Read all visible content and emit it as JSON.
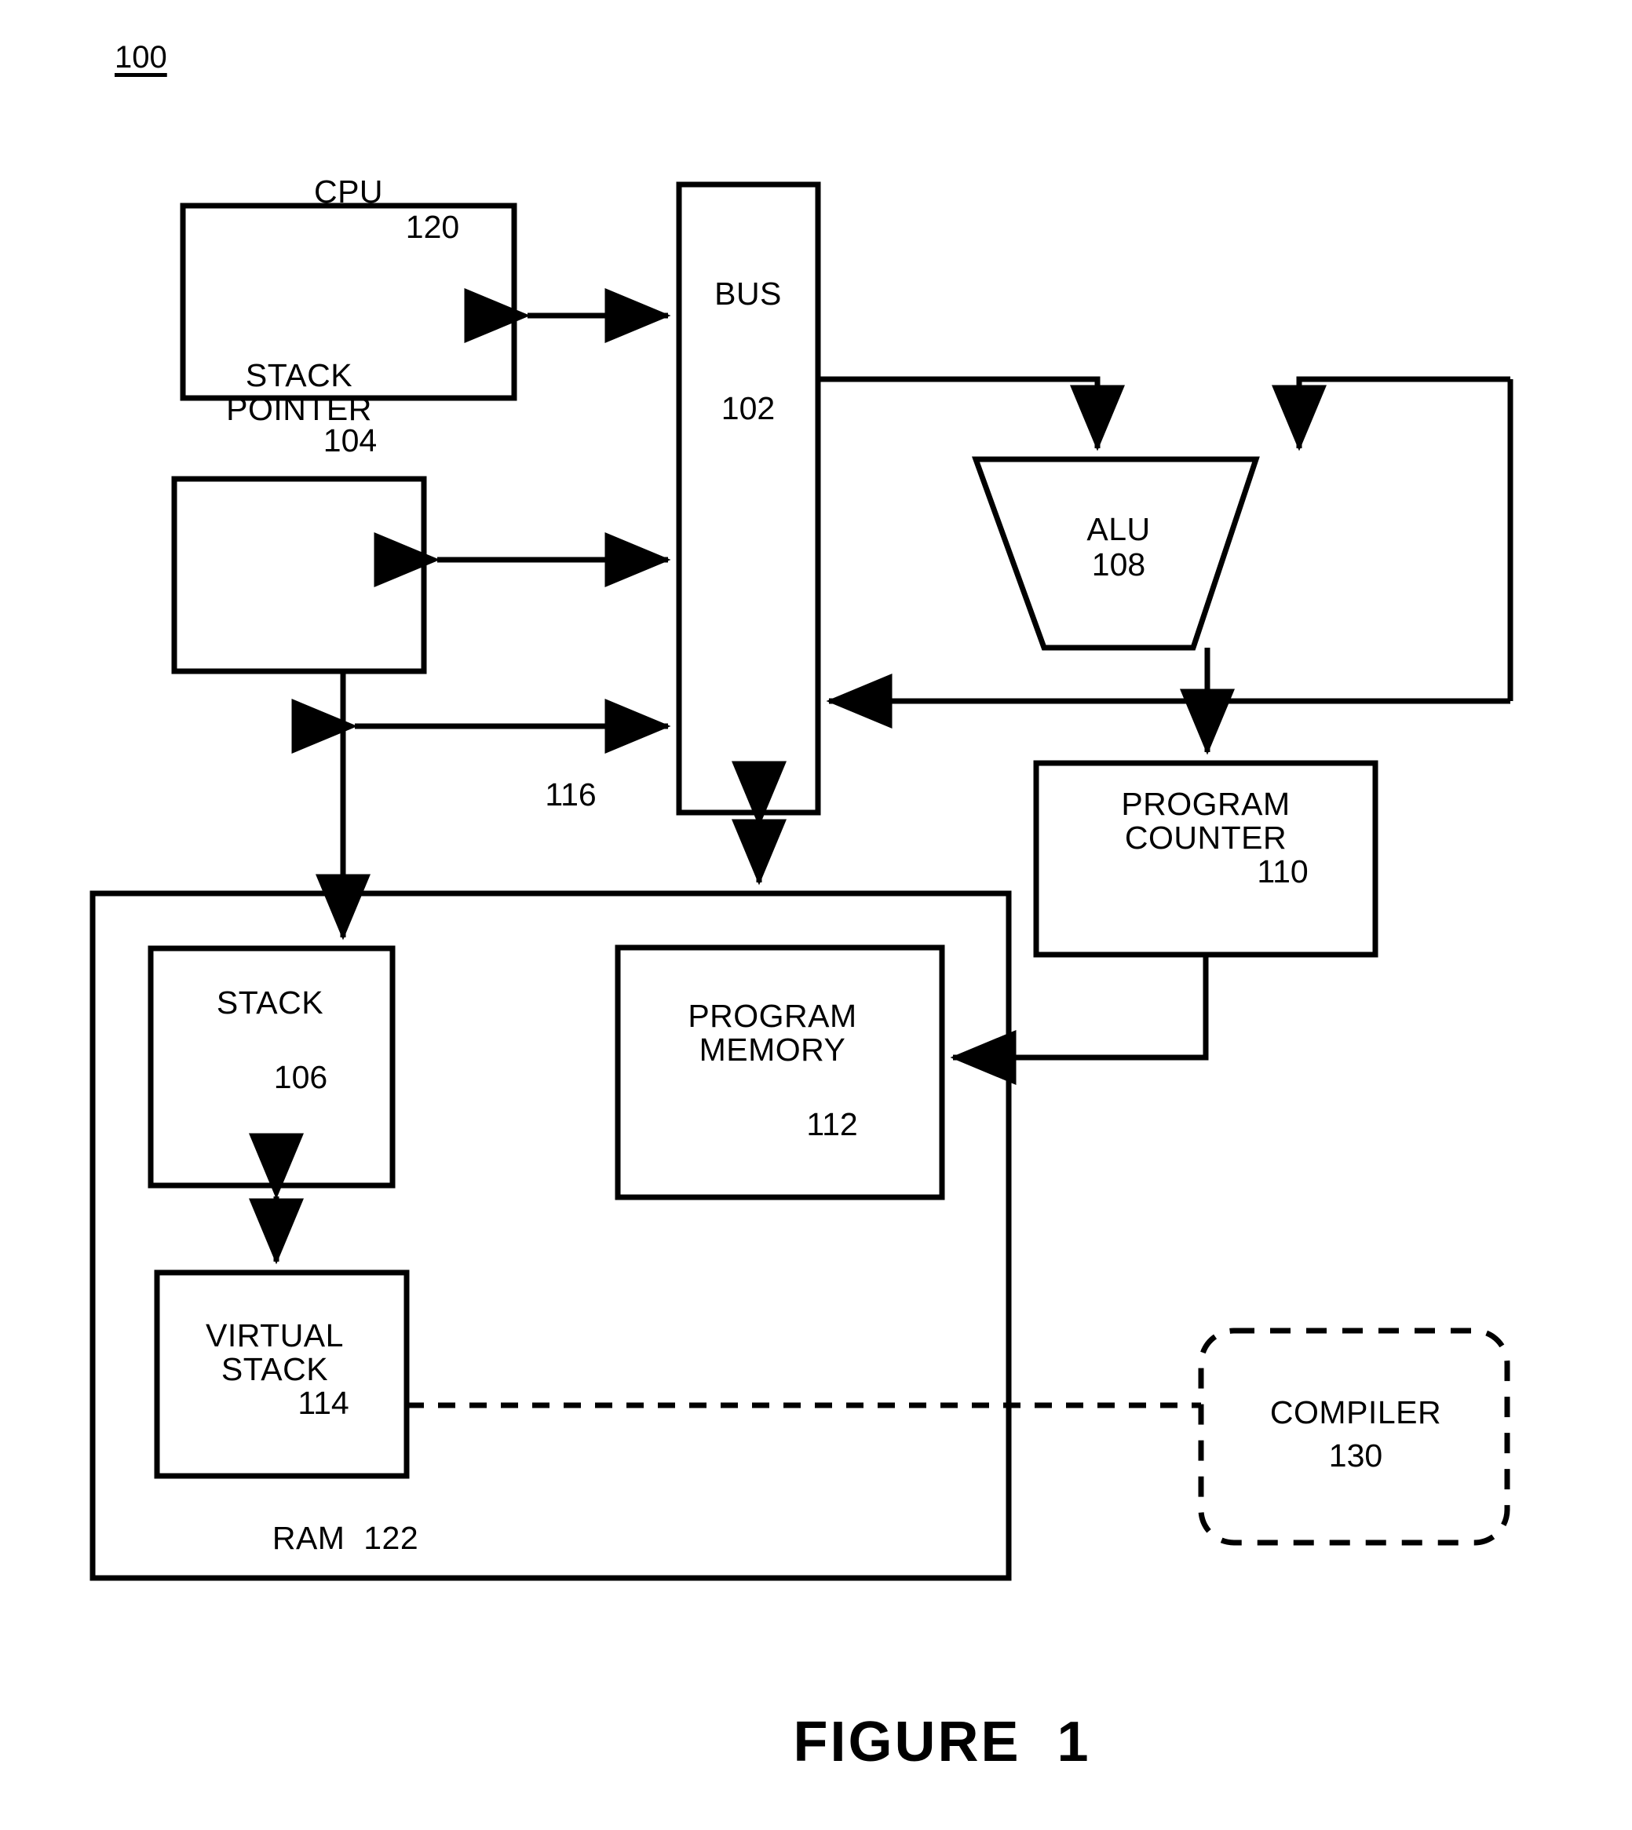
{
  "figure": {
    "ref_number": "100",
    "caption": "FIGURE  1"
  },
  "blocks": {
    "cpu": {
      "title": "CPU",
      "ref": "120"
    },
    "stack_pointer": {
      "line1": "STACK",
      "line2": "POINTER",
      "ref": "104"
    },
    "bus": {
      "title": "BUS",
      "ref": "102"
    },
    "alu": {
      "title": "ALU",
      "ref": "108"
    },
    "program_counter": {
      "line1": "PROGRAM",
      "line2": "COUNTER",
      "ref": "110"
    },
    "stack": {
      "title": "STACK",
      "ref": "106"
    },
    "program_memory": {
      "line1": "PROGRAM",
      "line2": "MEMORY",
      "ref": "112"
    },
    "virtual_stack": {
      "line1": "VIRTUAL",
      "line2": "STACK",
      "ref": "114"
    },
    "ram": {
      "title": "RAM  122"
    },
    "compiler": {
      "title": "COMPILER",
      "ref": "130"
    }
  },
  "connectors": {
    "sp_bus_lower_ref": "116"
  },
  "style": {
    "stroke": "#000000",
    "background": "#ffffff"
  }
}
